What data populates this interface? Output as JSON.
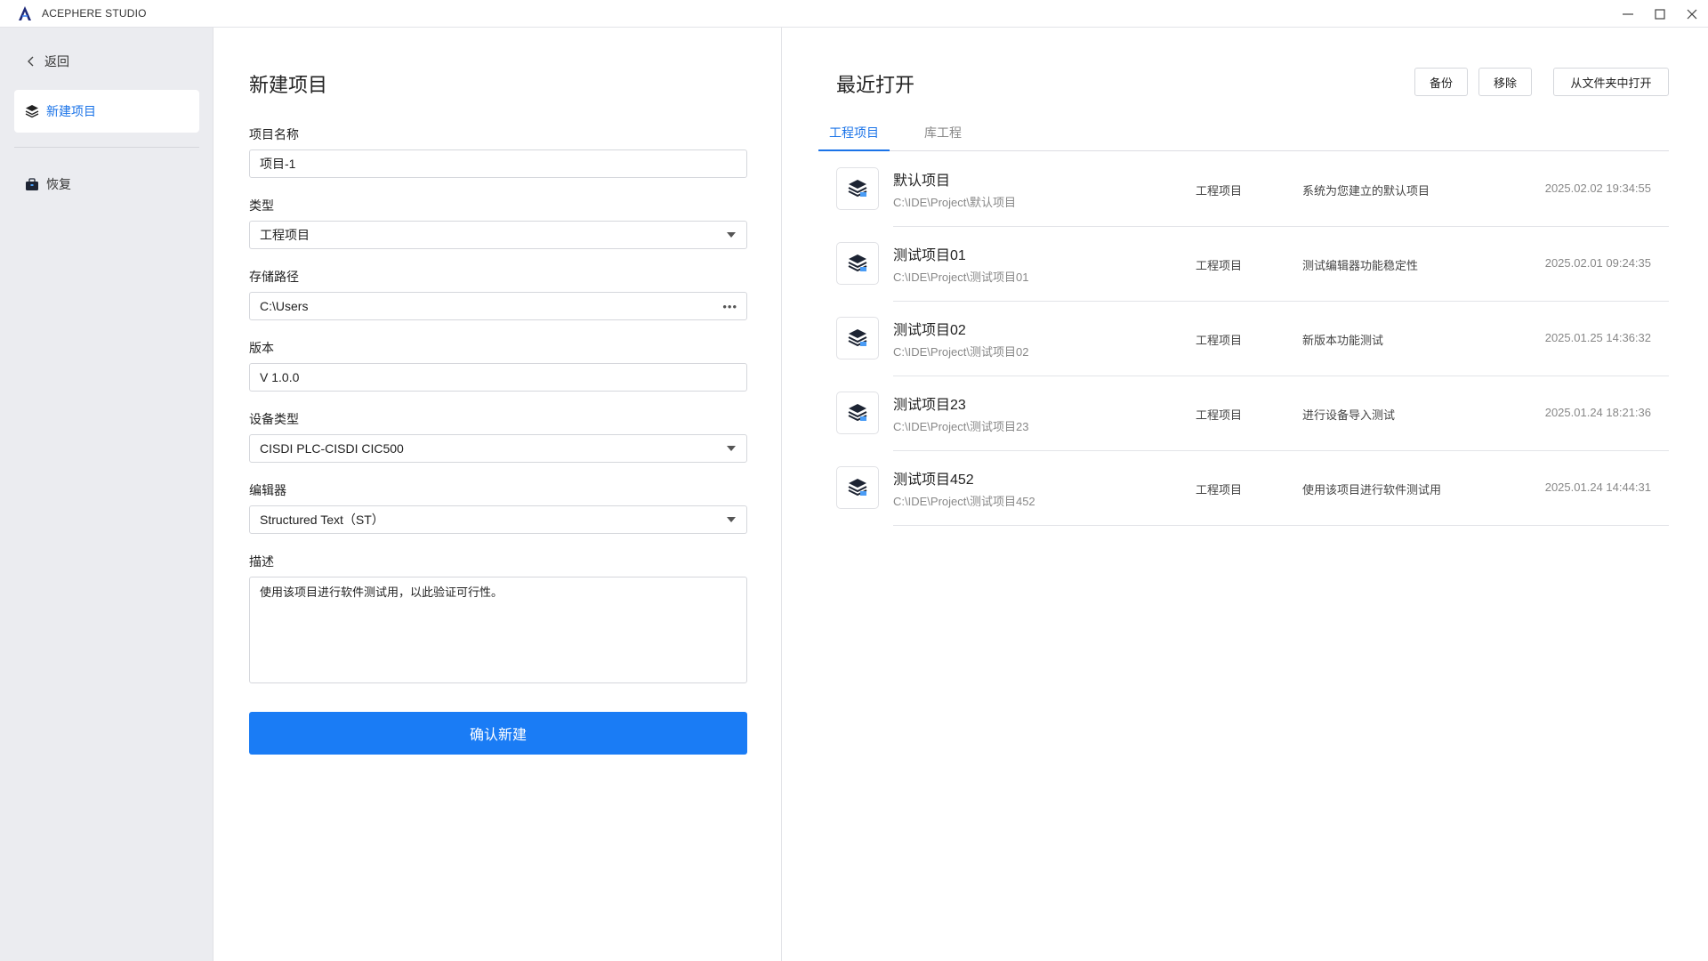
{
  "app": {
    "title": "ACEPHERE STUDIO",
    "brand_color": "#1f2a7a",
    "accent_color": "#1a7cf5"
  },
  "sidebar": {
    "back_label": "返回",
    "items": [
      {
        "label": "新建项目",
        "icon": "stack-layers-icon",
        "active": true
      },
      {
        "label": "恢复",
        "icon": "briefcase-icon",
        "active": false
      }
    ]
  },
  "form": {
    "title": "新建项目",
    "name": {
      "label": "项目名称",
      "value": "项目-1"
    },
    "type": {
      "label": "类型",
      "value": "工程项目"
    },
    "path": {
      "label": "存储路径",
      "value": "C:\\Users",
      "browse_glyph": "•••"
    },
    "version": {
      "label": "版本",
      "value": "V 1.0.0"
    },
    "device": {
      "label": "设备类型",
      "value": "CISDI PLC-CISDI CIC500"
    },
    "editor": {
      "label": "编辑器",
      "value": "Structured Text（ST）"
    },
    "description": {
      "label": "描述",
      "value": "使用该项目进行软件测试用，以此验证可行性。"
    },
    "submit_label": "确认新建"
  },
  "recent": {
    "title": "最近打开",
    "buttons": {
      "backup": "备份",
      "remove": "移除",
      "open_folder": "从文件夹中打开"
    },
    "tabs": [
      {
        "label": "工程项目",
        "active": true
      },
      {
        "label": "库工程",
        "active": false
      }
    ],
    "projects": [
      {
        "name": "默认项目",
        "path": "C:\\IDE\\Project\\默认项目",
        "type": "工程项目",
        "desc": "系统为您建立的默认项目",
        "time": "2025.02.02 19:34:55"
      },
      {
        "name": "测试项目01",
        "path": "C:\\IDE\\Project\\测试项目01",
        "type": "工程项目",
        "desc": "测试编辑器功能稳定性",
        "time": "2025.02.01 09:24:35"
      },
      {
        "name": "测试项目02",
        "path": "C:\\IDE\\Project\\测试项目02",
        "type": "工程项目",
        "desc": "新版本功能测试",
        "time": "2025.01.25 14:36:32"
      },
      {
        "name": "测试项目23",
        "path": "C:\\IDE\\Project\\测试项目23",
        "type": "工程项目",
        "desc": "进行设备导入测试",
        "time": "2025.01.24 18:21:36"
      },
      {
        "name": "测试项目452",
        "path": "C:\\IDE\\Project\\测试项目452",
        "type": "工程项目",
        "desc": "使用该项目进行软件测试用",
        "time": "2025.01.24 14:44:31"
      }
    ]
  }
}
